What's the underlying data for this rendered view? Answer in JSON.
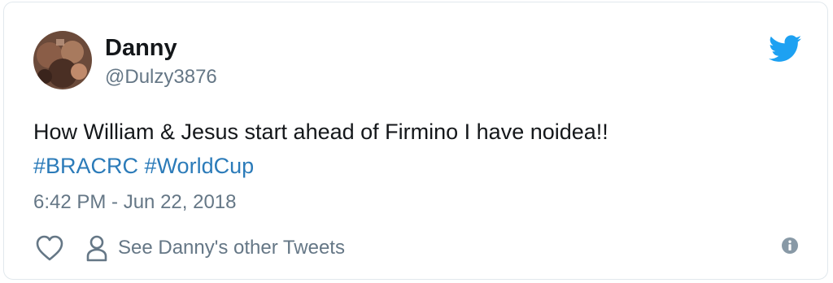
{
  "user": {
    "display_name": "Danny",
    "handle": "@Dulzy3876"
  },
  "tweet": {
    "text_line1": "How William & Jesus start ahead of Firmino I have noidea!!",
    "hashtags": [
      "#BRACRC",
      "#WorldCup"
    ],
    "timestamp": "6:42 PM - Jun 22, 2018"
  },
  "actions": {
    "see_other_label": "See Danny's other Tweets"
  },
  "icons": {
    "brand": "twitter-bird-icon",
    "like": "heart-icon",
    "profile": "person-icon",
    "info": "info-icon"
  },
  "colors": {
    "brand_blue": "#1da1f2",
    "hashtag": "#2b7bb9",
    "muted": "#657786",
    "text": "#14171a",
    "border": "#e1e8ed"
  }
}
